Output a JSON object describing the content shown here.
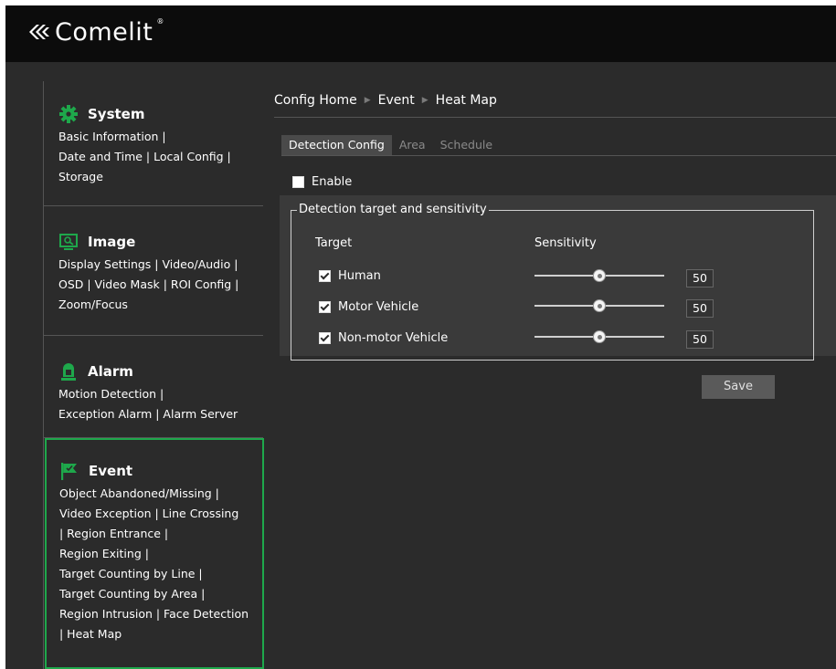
{
  "brand": {
    "name": "Comelit",
    "mark": "®"
  },
  "sidebar": {
    "groups": [
      {
        "title": "System",
        "icon": "gear-icon",
        "links": "Basic Information |\nDate and Time | Local Config |\nStorage"
      },
      {
        "title": "Image",
        "icon": "image-monitor-icon",
        "links": "Display Settings | Video/Audio |\nOSD | Video Mask | ROI Config |\nZoom/Focus"
      },
      {
        "title": "Alarm",
        "icon": "alarm-light-icon",
        "links": "Motion Detection |\nException Alarm | Alarm Server"
      },
      {
        "title": "Event",
        "icon": "event-flag-icon",
        "links": "Object Abandoned/Missing |\nVideo Exception | Line Crossing\n | Region Entrance |\nRegion Exiting |\nTarget Counting by Line |\nTarget Counting by Area |\nRegion Intrusion | Face Detection\n | Heat Map"
      }
    ]
  },
  "breadcrumb": {
    "items": [
      "Config Home",
      "Event",
      "Heat Map"
    ]
  },
  "tabs": [
    {
      "label": "Detection Config",
      "active": true
    },
    {
      "label": "Area",
      "active": false
    },
    {
      "label": "Schedule",
      "active": false
    }
  ],
  "enable": {
    "label": "Enable",
    "checked": false
  },
  "detection": {
    "legend": "Detection target and sensitivity",
    "target_header": "Target",
    "sensitivity_header": "Sensitivity",
    "rows": [
      {
        "label": "Human",
        "checked": true,
        "value": "50",
        "level": 0.5
      },
      {
        "label": "Motor Vehicle",
        "checked": true,
        "value": "50",
        "level": 0.5
      },
      {
        "label": "Non-motor Vehicle",
        "checked": true,
        "value": "50",
        "level": 0.5
      }
    ]
  },
  "save_label": "Save",
  "colors": {
    "accent": "#1ea84b",
    "background": "#2b2b2b",
    "topbar": "#0c0c0c"
  }
}
